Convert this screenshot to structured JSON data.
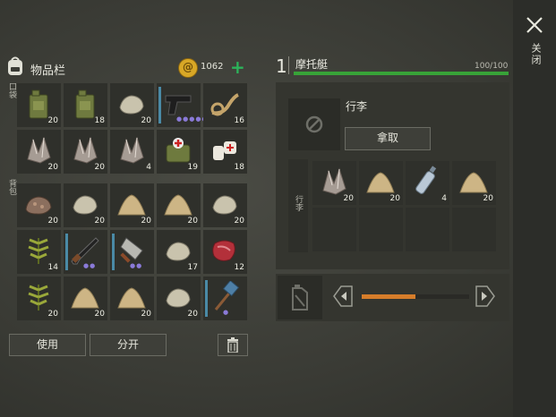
{
  "window": {
    "close_label": "关闭"
  },
  "inventory": {
    "title": "物品栏",
    "coins": "1062",
    "pocket_label": "口袋",
    "backpack_label": "背包",
    "pocket": [
      {
        "icon": "jerrycan-icon",
        "qty": "20"
      },
      {
        "icon": "jerrycan-icon",
        "qty": "18"
      },
      {
        "icon": "stone-icon",
        "qty": "20"
      },
      {
        "icon": "pistol-icon",
        "qty": "",
        "durability": "●●●●●"
      },
      {
        "icon": "rope-icon",
        "qty": "16"
      },
      {
        "icon": "crystal-ore-icon",
        "qty": "20"
      },
      {
        "icon": "crystal-ore-icon",
        "qty": "20"
      },
      {
        "icon": "crystal-ore-icon",
        "qty": "4"
      },
      {
        "icon": "medkit-bag-icon",
        "qty": "19"
      },
      {
        "icon": "bandage-icon",
        "qty": "18"
      }
    ],
    "backpack": [
      {
        "icon": "iron-ore-icon",
        "qty": "20"
      },
      {
        "icon": "stone-icon",
        "qty": "20"
      },
      {
        "icon": "sand-icon",
        "qty": "20"
      },
      {
        "icon": "sand-icon",
        "qty": "20"
      },
      {
        "icon": "stone-icon",
        "qty": "20"
      },
      {
        "icon": "plant-fiber-icon",
        "qty": "14"
      },
      {
        "icon": "shotgun-icon",
        "qty": "",
        "durability": "●●"
      },
      {
        "icon": "cleaver-icon",
        "qty": "",
        "durability": "●●"
      },
      {
        "icon": "stone-icon",
        "qty": "17"
      },
      {
        "icon": "raw-meat-icon",
        "qty": "12"
      },
      {
        "icon": "plant-fiber-icon",
        "qty": "20"
      },
      {
        "icon": "sand-icon",
        "qty": "20"
      },
      {
        "icon": "sand-icon",
        "qty": "20"
      },
      {
        "icon": "stone-icon",
        "qty": "20"
      },
      {
        "icon": "sledgehammer-icon",
        "qty": "",
        "durability": "●"
      }
    ],
    "use_label": "使用",
    "split_label": "分开",
    "trash_icon": "trash-icon"
  },
  "vehicle": {
    "number": "1",
    "name": "摩托艇",
    "capacity": "100/100",
    "health_color": "#38a338",
    "luggage_title": "行李",
    "take_label": "拿取",
    "cargo_side_label": "行李",
    "cargo": [
      {
        "icon": "crystal-ore-icon",
        "qty": "20"
      },
      {
        "icon": "sand-icon",
        "qty": "20"
      },
      {
        "icon": "water-bottle-icon",
        "qty": "4"
      },
      {
        "icon": "sand-icon",
        "qty": "20"
      },
      {
        "icon": "",
        "qty": ""
      },
      {
        "icon": "",
        "qty": ""
      },
      {
        "icon": "",
        "qty": ""
      },
      {
        "icon": "",
        "qty": ""
      }
    ],
    "fuel_level": 0.5,
    "fuel_color": "#d67d2a"
  }
}
